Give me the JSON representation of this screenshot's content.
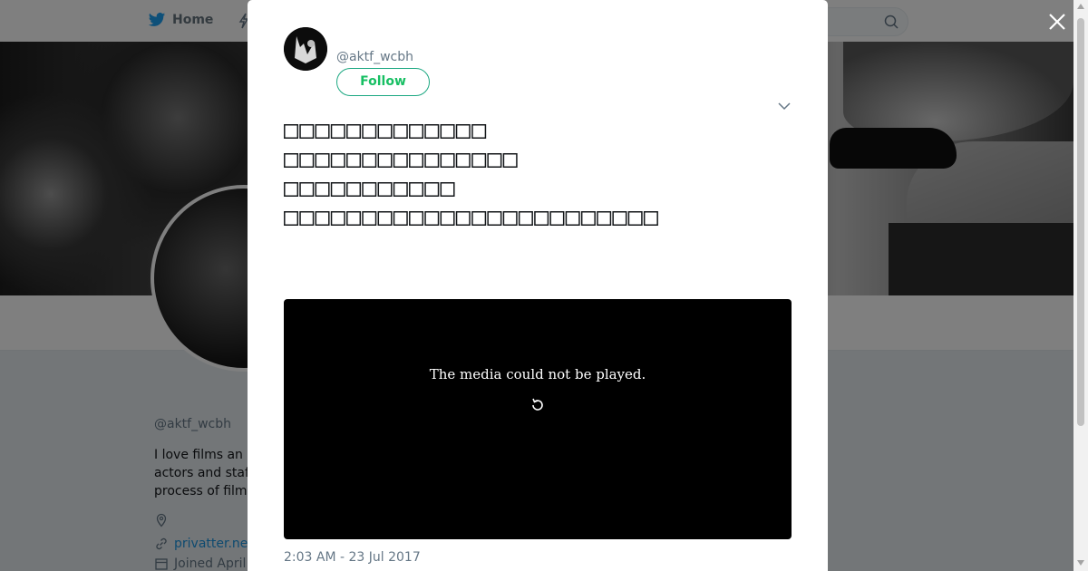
{
  "topbar": {
    "home_label": "Home",
    "icons": [
      "twitter-bird-icon",
      "moments-icon",
      "search-icon"
    ]
  },
  "profile": {
    "handle": "@aktf_wcbh",
    "bio": "  I love films an\nactors and staf\nprocess of film",
    "link_text": "privatter.ne",
    "joined_text": "Joined April"
  },
  "tweet": {
    "handle": "@aktf_wcbh",
    "follow_label": "Follow",
    "text_lines": [
      "□□□□□□□□□□□□□",
      "□□□□□□□□□□□□□□□",
      "□□□□□□□□□□□",
      "□□□□□□□□□□□□□□□□□□□□□□□□"
    ],
    "media_message": "The media could not be played.",
    "timestamp": "2:03 AM - 23 Jul 2017"
  },
  "colors": {
    "accent_green": "#17bf63",
    "link_blue": "#1b95e0",
    "text_gray": "#657786",
    "overlay": "rgba(0,0,0,0.5)"
  }
}
